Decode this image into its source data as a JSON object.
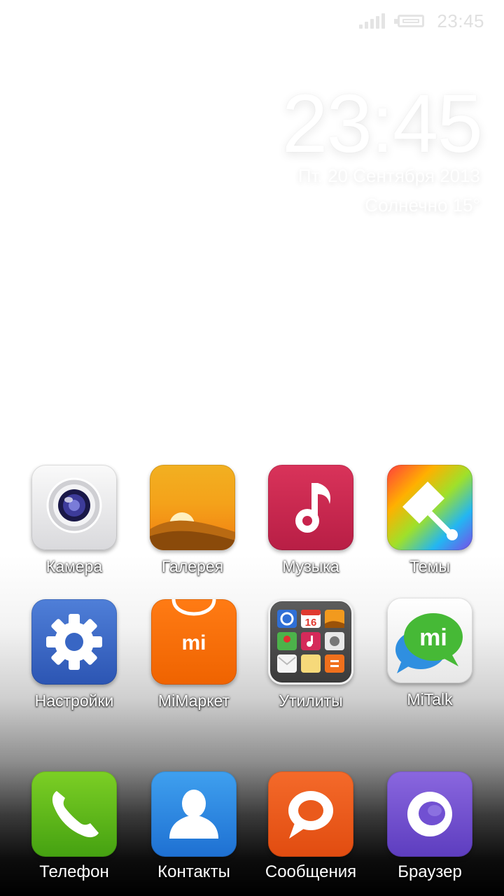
{
  "status_bar": {
    "time": "23:45",
    "signal_icon": "signal-icon",
    "battery_icon": "battery-icon"
  },
  "clock_widget": {
    "time": "23:45",
    "date": "Пт. 20 Сентября 2013",
    "weather": "Солнечно 15°"
  },
  "apps": [
    {
      "label": "Камера",
      "icon": "camera-icon"
    },
    {
      "label": "Галерея",
      "icon": "gallery-icon"
    },
    {
      "label": "Музыка",
      "icon": "music-note-icon"
    },
    {
      "label": "Темы",
      "icon": "paintbrush-icon"
    },
    {
      "label": "Настройки",
      "icon": "gear-icon"
    },
    {
      "label": "MiМаркет",
      "icon": "shopping-bag-icon"
    },
    {
      "label": "Утилиты",
      "icon": "folder-icon"
    },
    {
      "label": "MiTalk",
      "icon": "chat-bubble-icon"
    }
  ],
  "dock": [
    {
      "label": "Телефон",
      "icon": "phone-icon"
    },
    {
      "label": "Контакты",
      "icon": "person-icon"
    },
    {
      "label": "Сообщения",
      "icon": "message-bubble-icon"
    },
    {
      "label": "Браузер",
      "icon": "browser-ring-icon"
    }
  ],
  "utilities_folder": {
    "calendar_day": "16"
  },
  "market_logo": "mi",
  "mitalk_logo": "mi",
  "colors": {
    "gallery": "#f4a21a",
    "music": "#c8244d",
    "settings": "#3866c4",
    "market": "#f36d0a",
    "phone": "#5cb81a",
    "contacts": "#2b86e0",
    "messages": "#ea5a1c",
    "browser": "#7150d2"
  }
}
